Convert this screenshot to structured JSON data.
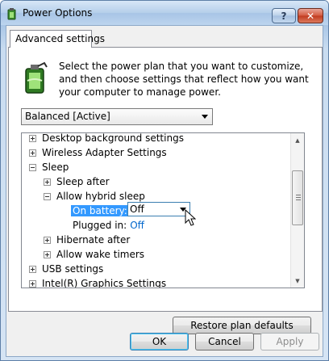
{
  "window": {
    "title": "Power Options",
    "help_label": "?",
    "close_label": "✕"
  },
  "tab": {
    "label": "Advanced settings"
  },
  "intro": {
    "text": "Select the power plan that you want to customize, and then choose settings that reflect how you want your computer to manage power."
  },
  "plan_select": {
    "value": "Balanced [Active]"
  },
  "tree": {
    "items": [
      {
        "label": "Desktop background settings"
      },
      {
        "label": "Wireless Adapter Settings"
      },
      {
        "label": "Sleep"
      },
      {
        "label": "Sleep after"
      },
      {
        "label": "Allow hybrid sleep"
      },
      {
        "label": "On battery:",
        "value": "Off"
      },
      {
        "label": "Plugged in:",
        "value": "Off"
      },
      {
        "label": "Hibernate after"
      },
      {
        "label": "Allow wake timers"
      },
      {
        "label": "USB settings"
      },
      {
        "label": "Intel(R) Graphics Settings"
      }
    ]
  },
  "buttons": {
    "restore": "Restore plan defaults",
    "ok": "OK",
    "cancel": "Cancel",
    "apply": "Apply"
  },
  "colors": {
    "selection": "#3399ff",
    "link": "#0066cc"
  }
}
